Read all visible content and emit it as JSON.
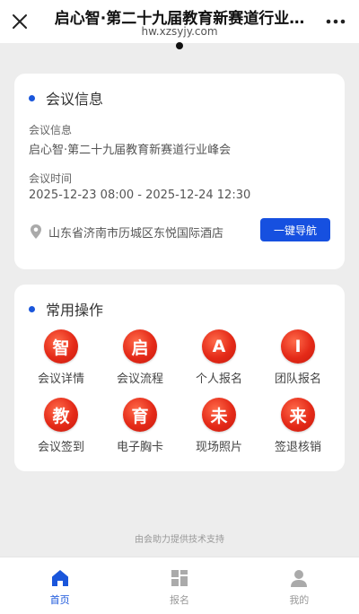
{
  "browser": {
    "title": "启心智·第二十九届教育新赛道行业…",
    "url": "hw.xzsyjy.com"
  },
  "meeting_info": {
    "section_title": "会议信息",
    "name_label": "会议信息",
    "name_value": "启心智·第二十九届教育新赛道行业峰会",
    "time_label": "会议时间",
    "time_value": "2025-12-23 08:00 - 2025-12-24 12:30",
    "address": "山东省济南市历城区东悦国际酒店",
    "nav_button": "一键导航"
  },
  "common_ops": {
    "section_title": "常用操作",
    "items": [
      {
        "char": "智",
        "label": "会议详情"
      },
      {
        "char": "启",
        "label": "会议流程"
      },
      {
        "char": "A",
        "label": "个人报名"
      },
      {
        "char": "I",
        "label": "团队报名"
      },
      {
        "char": "教",
        "label": "会议签到"
      },
      {
        "char": "育",
        "label": "电子胸卡"
      },
      {
        "char": "未",
        "label": "现场照片"
      },
      {
        "char": "来",
        "label": "签退核销"
      }
    ]
  },
  "footer": {
    "support_text": "由会助力提供技术支持"
  },
  "tabbar": {
    "tabs": [
      {
        "label": "首页",
        "icon": "home-icon",
        "active": true
      },
      {
        "label": "报名",
        "icon": "grid-icon",
        "active": false
      },
      {
        "label": "我的",
        "icon": "user-icon",
        "active": false
      }
    ]
  },
  "colors": {
    "accent": "#1a56db",
    "button": "#1650e0",
    "icon_red": "#e42a18",
    "background": "#ededed"
  }
}
